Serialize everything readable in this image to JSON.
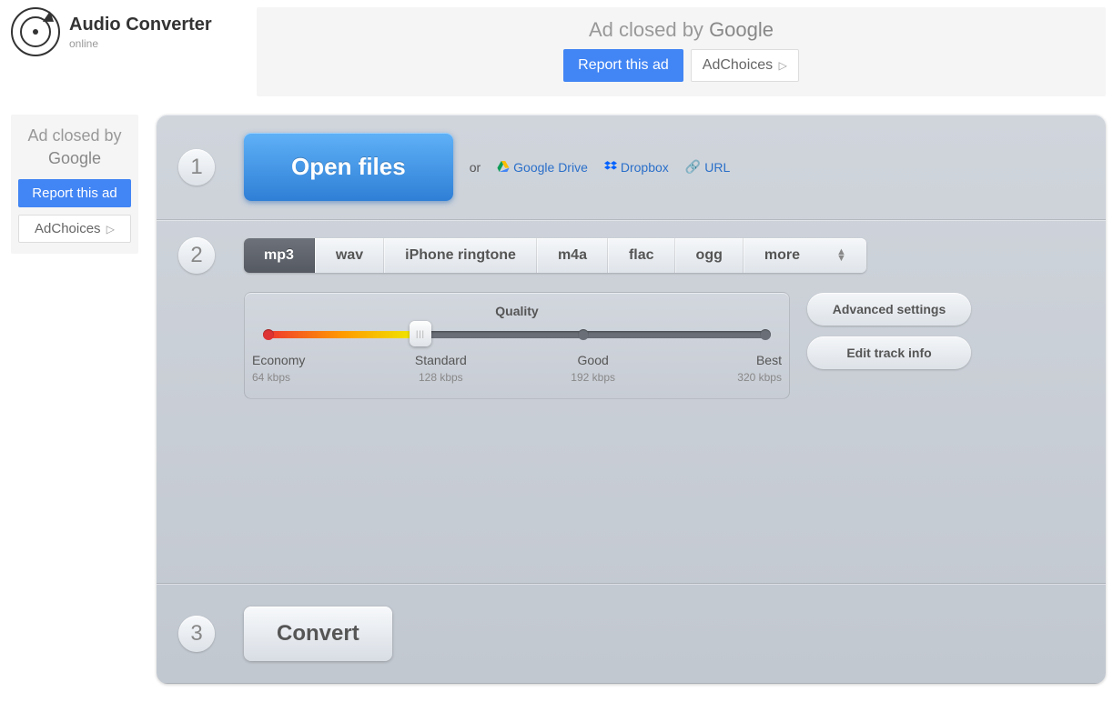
{
  "header": {
    "title": "Audio Converter",
    "subtitle": "online"
  },
  "top_ad": {
    "closed_text": "Ad closed by",
    "google": "Google",
    "report": "Report this ad",
    "adchoices": "AdChoices"
  },
  "left_ad": {
    "closed_text": "Ad closed by",
    "google": "Google",
    "report": "Report this ad",
    "adchoices": "AdChoices"
  },
  "steps": {
    "s1": "1",
    "s2": "2",
    "s3": "3"
  },
  "open": {
    "button": "Open files",
    "or": "or",
    "gdrive": "Google Drive",
    "dropbox": "Dropbox",
    "url": "URL"
  },
  "formats": {
    "mp3": "mp3",
    "wav": "wav",
    "iphone": "iPhone ringtone",
    "m4a": "m4a",
    "flac": "flac",
    "ogg": "ogg",
    "more": "more"
  },
  "quality": {
    "title": "Quality",
    "levels": [
      {
        "name": "Economy",
        "rate": "64 kbps"
      },
      {
        "name": "Standard",
        "rate": "128 kbps"
      },
      {
        "name": "Good",
        "rate": "192 kbps"
      },
      {
        "name": "Best",
        "rate": "320 kbps"
      }
    ]
  },
  "side": {
    "advanced": "Advanced settings",
    "edit": "Edit track info"
  },
  "convert": {
    "button": "Convert"
  }
}
